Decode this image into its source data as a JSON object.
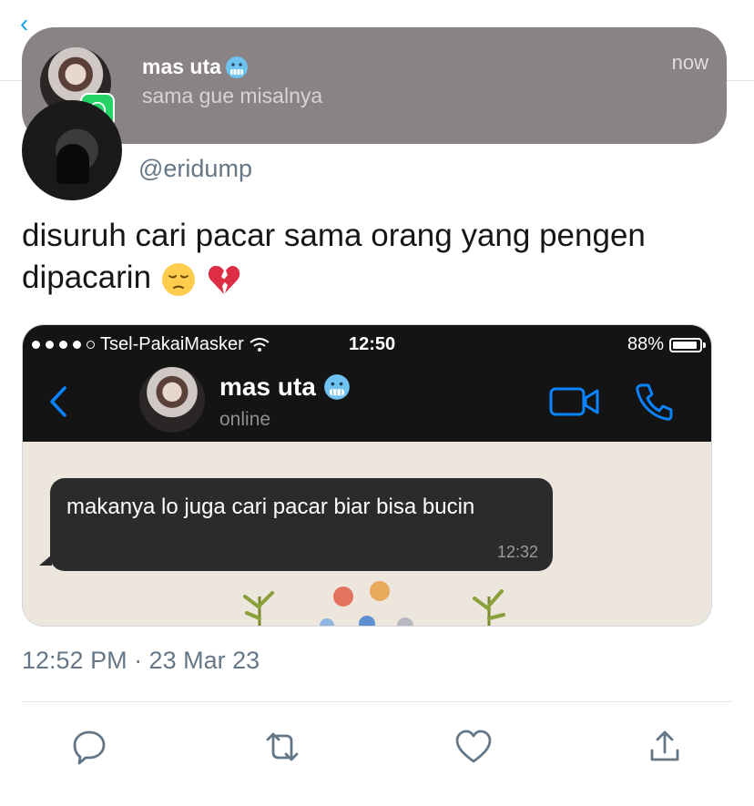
{
  "notification": {
    "name": "mas uta",
    "message": "sama gue misalnya",
    "time": "now"
  },
  "tweet": {
    "handle": "@eridump",
    "text": "disuruh cari pacar sama orang yang pengen dipacarin",
    "timestamp": "12:52 PM · 23 Mar 23"
  },
  "screenshot": {
    "carrier": "Tsel-PakaiMasker",
    "clock": "12:50",
    "battery": "88%",
    "contact_name": "mas uta",
    "contact_status": "online",
    "message_text": "makanya lo juga cari pacar biar bisa bucin",
    "message_time": "12:32"
  },
  "icons": {
    "reply": "reply-icon",
    "retweet": "retweet-icon",
    "like": "heart-icon",
    "share": "share-icon"
  },
  "colors": {
    "accent": "#1da1f2",
    "notification_bg": "#8a8385",
    "whatsapp": "#25d366",
    "ios_blue": "#0a84ff"
  }
}
